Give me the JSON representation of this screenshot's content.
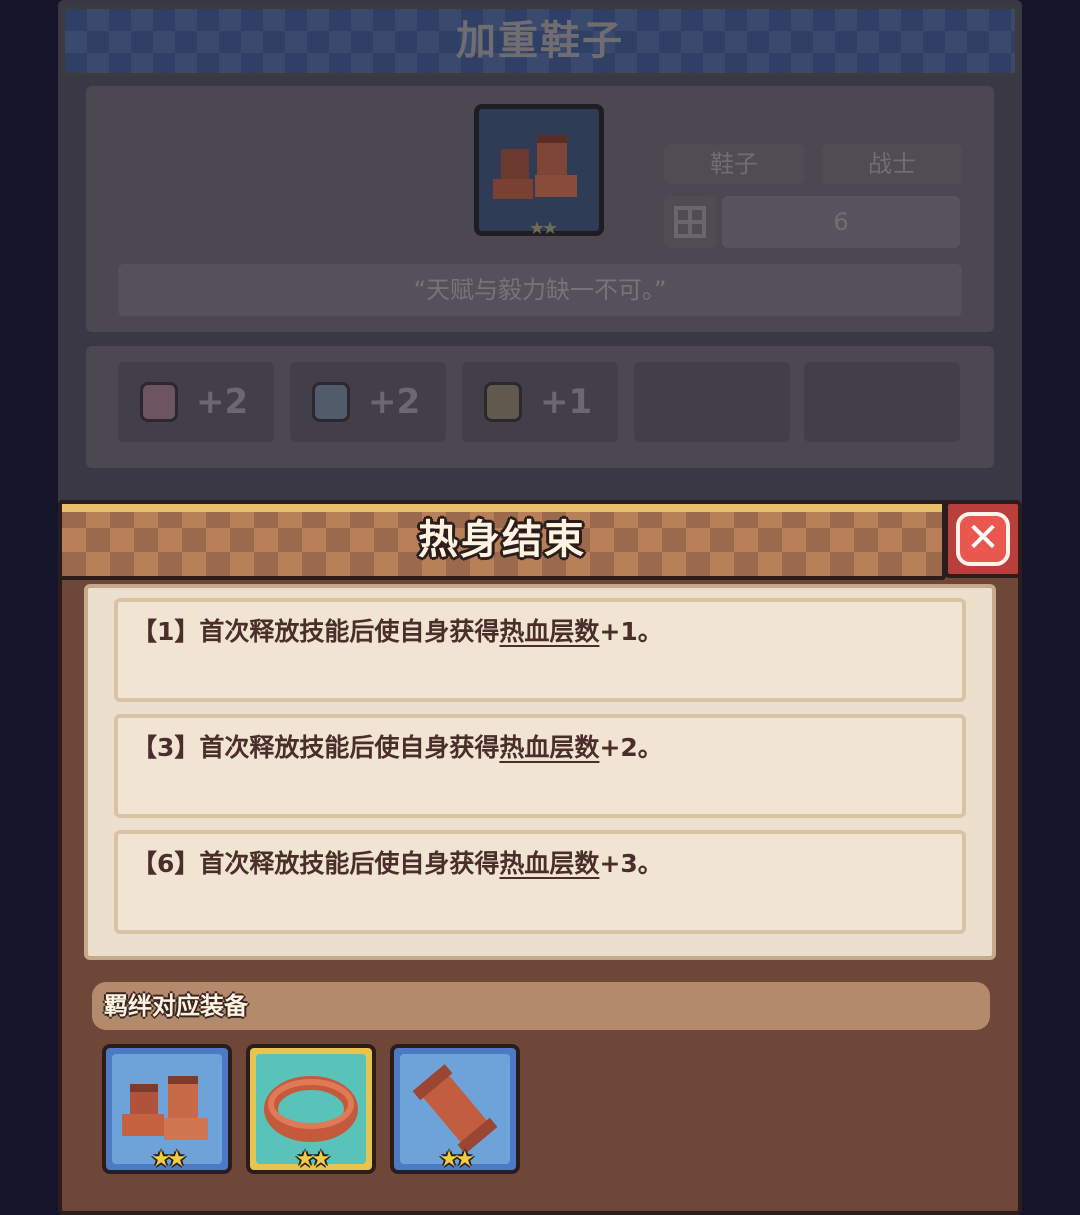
{
  "item_panel": {
    "title": "加重鞋子",
    "item_icon": "boots-icon",
    "item_stars": "★★",
    "tags": {
      "slot": "鞋子",
      "class": "战士"
    },
    "bond_count_icon": "grid-icon",
    "bond_count": "6",
    "quote": "“天赋与毅力缺一不可。”",
    "stats": [
      {
        "icon": "pink-shield-icon",
        "value": "+2"
      },
      {
        "icon": "book-icon",
        "value": "+2"
      },
      {
        "icon": "badge-icon",
        "value": "+1"
      }
    ]
  },
  "bond_popup": {
    "title": "热身结束",
    "close_icon": "close-icon",
    "effects": [
      {
        "tier": "【1】",
        "text": "首次释放技能后使自身获得",
        "keyword": "热血层数",
        "bonus": "+1。"
      },
      {
        "tier": "【3】",
        "text": "首次释放技能后使自身获得",
        "keyword": "热血层数",
        "bonus": "+2。"
      },
      {
        "tier": "【6】",
        "text": "首次释放技能后使自身获得",
        "keyword": "热血层数",
        "bonus": "+3。"
      }
    ],
    "equipment_label": "羁绊对应装备",
    "equipment": [
      {
        "icon": "boots-icon",
        "stars": "★★"
      },
      {
        "icon": "belt-icon",
        "stars": "★★"
      },
      {
        "icon": "bracer-icon",
        "stars": "★★"
      }
    ]
  },
  "colors": {
    "popup_body": "#6e4738",
    "effect_panel": "#ecdfcd",
    "effect_text": "#4a2e2a",
    "close_red": "#e9574f",
    "star_gold": "#f2cd43"
  }
}
